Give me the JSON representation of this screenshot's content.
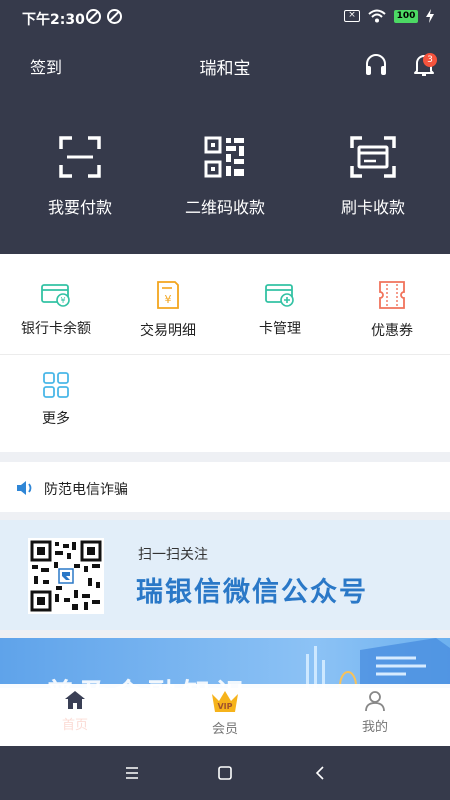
{
  "status_bar": {
    "time": "下午2:30",
    "battery": "100"
  },
  "header": {
    "signin_label": "签到",
    "title": "瑞和宝",
    "notification_count": "3"
  },
  "pay_actions": [
    {
      "label": "我要付款",
      "icon": "scan-frame-icon"
    },
    {
      "label": "二维码收款",
      "icon": "qr-code-icon"
    },
    {
      "label": "刷卡收款",
      "icon": "card-swipe-icon"
    }
  ],
  "features": [
    {
      "label": "银行卡余额",
      "icon": "bank-card-balance-icon",
      "color": "#33c2a4"
    },
    {
      "label": "交易明细",
      "icon": "transaction-detail-icon",
      "color": "#f3a51e"
    },
    {
      "label": "卡管理",
      "icon": "card-manage-icon",
      "color": "#33c2a4"
    },
    {
      "label": "优惠券",
      "icon": "coupon-icon",
      "color": "#f1735b"
    },
    {
      "label": "更多",
      "icon": "more-grid-icon",
      "color": "#4ab7e8"
    }
  ],
  "notice": {
    "text": "防范电信诈骗"
  },
  "qr_banner": {
    "subtitle": "扫一扫关注",
    "title": "瑞银信微信公众号"
  },
  "promo_banner": {
    "text": "普及金融知识"
  },
  "tab_bar": [
    {
      "label": "首页",
      "icon": "home-icon"
    },
    {
      "label": "会员",
      "icon": "vip-crown-icon"
    },
    {
      "label": "我的",
      "icon": "profile-icon"
    }
  ],
  "colors": {
    "header_bg": "#363a4b",
    "accent_blue": "#2a78c7",
    "badge_red": "#f5533d"
  }
}
